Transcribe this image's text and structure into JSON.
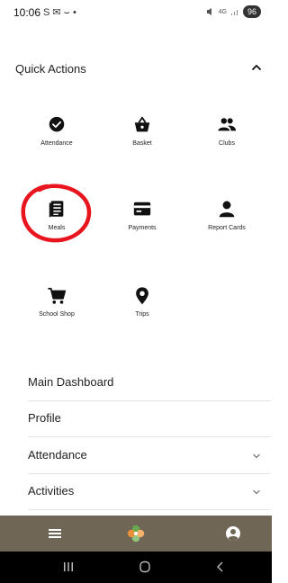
{
  "status_bar": {
    "time": "10:06",
    "notification_text": "S ✉ ⌣ •",
    "battery": "96",
    "signal_text": "4G"
  },
  "quick_actions": {
    "title": "Quick Actions",
    "items": [
      {
        "label": "Attendance",
        "icon": "check-circle-icon"
      },
      {
        "label": "Basket",
        "icon": "basket-icon"
      },
      {
        "label": "Clubs",
        "icon": "people-icon"
      },
      {
        "label": "Meals",
        "icon": "menu-book-icon"
      },
      {
        "label": "Payments",
        "icon": "credit-card-icon"
      },
      {
        "label": "Report Cards",
        "icon": "person-icon"
      },
      {
        "label": "School Shop",
        "icon": "shopping-cart-icon"
      },
      {
        "label": "Trips",
        "icon": "location-pin-icon"
      }
    ]
  },
  "menu": [
    {
      "label": "Main Dashboard",
      "expandable": false
    },
    {
      "label": "Profile",
      "expandable": false
    },
    {
      "label": "Attendance",
      "expandable": true
    },
    {
      "label": "Activities",
      "expandable": true
    }
  ],
  "colors": {
    "bottom_nav_bg": "#6f6655",
    "annotation_red": "#e8141e",
    "logo_green": "#6aa84f",
    "logo_orange": "#e69138"
  }
}
